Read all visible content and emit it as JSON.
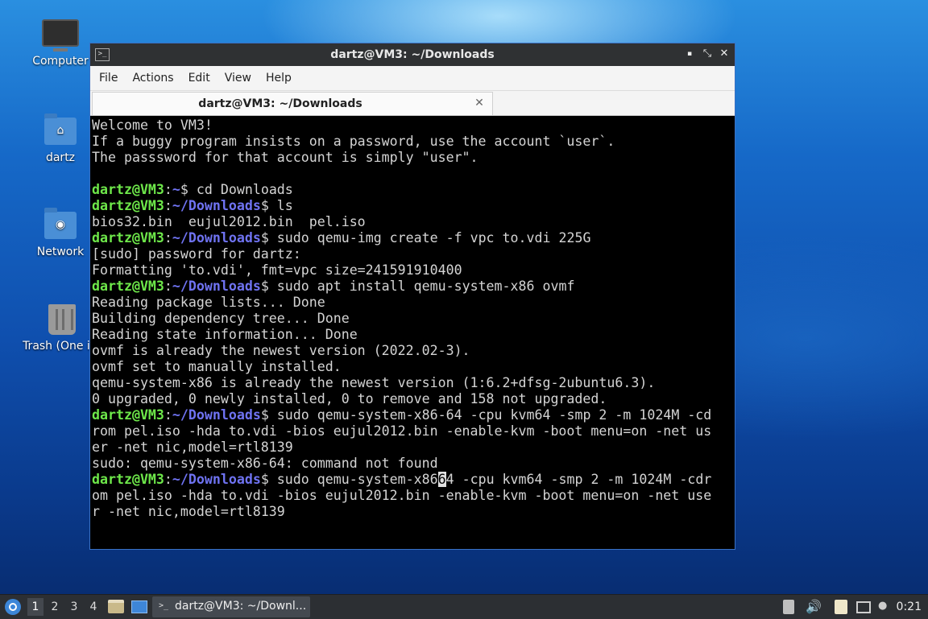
{
  "desktop": {
    "icons": [
      {
        "label": "Computer",
        "icon": "computer-icon"
      },
      {
        "label": "dartz",
        "icon": "home-folder-icon"
      },
      {
        "label": "Network",
        "icon": "network-folder-icon"
      },
      {
        "label": "Trash (One ite",
        "icon": "trash-icon"
      }
    ]
  },
  "window": {
    "title": "dartz@VM3: ~/Downloads",
    "controls": {
      "minimize": "▪",
      "maximize": "⤡",
      "close": "✕"
    },
    "menu": [
      "File",
      "Actions",
      "Edit",
      "View",
      "Help"
    ],
    "tab": {
      "label": "dartz@VM3: ~/Downloads",
      "close": "✕"
    }
  },
  "terminal": {
    "prompt_user": "dartz@VM3",
    "lines": [
      {
        "type": "out",
        "text": "Welcome to VM3!"
      },
      {
        "type": "out",
        "text": "If a buggy program insists on a password, use the account `user`."
      },
      {
        "type": "out",
        "text": "The passsword for that account is simply \"user\"."
      },
      {
        "type": "out",
        "text": ""
      },
      {
        "type": "cmd",
        "user": "dartz@VM3",
        "path": "~",
        "cmd": "$ cd Downloads"
      },
      {
        "type": "cmd",
        "user": "dartz@VM3",
        "path": "~/Downloads",
        "cmd": "$ ls"
      },
      {
        "type": "out",
        "text": "bios32.bin  eujul2012.bin  pel.iso"
      },
      {
        "type": "cmd",
        "user": "dartz@VM3",
        "path": "~/Downloads",
        "cmd": "$ sudo qemu-img create -f vpc to.vdi 225G"
      },
      {
        "type": "out",
        "text": "[sudo] password for dartz:"
      },
      {
        "type": "out",
        "text": "Formatting 'to.vdi', fmt=vpc size=241591910400"
      },
      {
        "type": "cmd",
        "user": "dartz@VM3",
        "path": "~/Downloads",
        "cmd": "$ sudo apt install qemu-system-x86 ovmf"
      },
      {
        "type": "out",
        "text": "Reading package lists... Done"
      },
      {
        "type": "out",
        "text": "Building dependency tree... Done"
      },
      {
        "type": "out",
        "text": "Reading state information... Done"
      },
      {
        "type": "out",
        "text": "ovmf is already the newest version (2022.02-3)."
      },
      {
        "type": "out",
        "text": "ovmf set to manually installed."
      },
      {
        "type": "out",
        "text": "qemu-system-x86 is already the newest version (1:6.2+dfsg-2ubuntu6.3)."
      },
      {
        "type": "out",
        "text": "0 upgraded, 0 newly installed, 0 to remove and 158 not upgraded."
      },
      {
        "type": "cmd",
        "user": "dartz@VM3",
        "path": "~/Downloads",
        "cmd": "$ sudo qemu-system-x86-64 -cpu kvm64 -smp 2 -m 1024M -cd"
      },
      {
        "type": "out",
        "text": "rom pel.iso -hda to.vdi -bios eujul2012.bin -enable-kvm -boot menu=on -net us"
      },
      {
        "type": "out",
        "text": "er -net nic,model=rtl8139"
      },
      {
        "type": "out",
        "text": "sudo: qemu-system-x86-64: command not found"
      },
      {
        "type": "cursor",
        "user": "dartz@VM3",
        "path": "~/Downloads",
        "before": "$ sudo qemu-system-x86",
        "cursor_char": "6",
        "after": "4 -cpu kvm64 -smp 2 -m 1024M -cdr"
      },
      {
        "type": "out",
        "text": "om pel.iso -hda to.vdi -bios eujul2012.bin -enable-kvm -boot menu=on -net use"
      },
      {
        "type": "out",
        "text": "r -net nic,model=rtl8139"
      }
    ]
  },
  "taskbar": {
    "workspaces": [
      "1",
      "2",
      "3",
      "4"
    ],
    "active_workspace": "1",
    "task_label": "dartz@VM3: ~/Downl...",
    "clock": "0:21",
    "colors": {
      "panel": "#2c2f33",
      "prompt_user": "#6ee84a",
      "prompt_path": "#6f73f2",
      "accent": "#3a71c4"
    }
  }
}
